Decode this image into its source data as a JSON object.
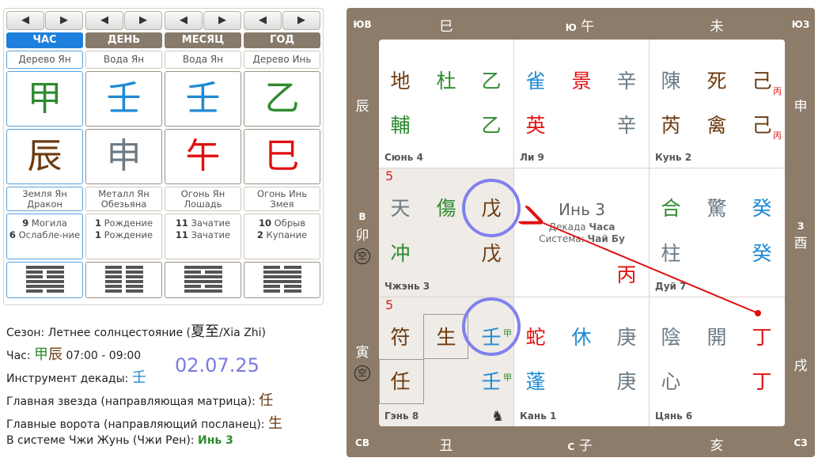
{
  "pillars": [
    {
      "nav_prev": "◀",
      "nav_next": "▶",
      "header": "ЧАС",
      "active": true,
      "element": "Дерево Ян",
      "stem": "甲",
      "stem_color": "#2e8b2e",
      "branch": "辰",
      "branch_color": "#6b3a10",
      "branch_desc": [
        "Земля Ян",
        "Дракон"
      ],
      "states": [
        [
          "9",
          "Могила"
        ],
        [
          "6",
          "Ослабле-ние"
        ]
      ]
    },
    {
      "nav_prev": "◀",
      "nav_next": "▶",
      "header": "ДЕНЬ",
      "active": false,
      "element": "Вода Ян",
      "stem": "壬",
      "stem_color": "#1f8ad6",
      "branch": "申",
      "branch_color": "#6c7a84",
      "branch_desc": [
        "Металл Ян",
        "Обезьяна"
      ],
      "states": [
        [
          "1",
          "Рождение"
        ],
        [
          "1",
          "Рождение"
        ]
      ]
    },
    {
      "nav_prev": "◀",
      "nav_next": "▶",
      "header": "МЕСЯЦ",
      "active": false,
      "element": "Вода Ян",
      "stem": "壬",
      "stem_color": "#1f8ad6",
      "branch": "午",
      "branch_color": "#e01010",
      "branch_desc": [
        "Огонь Ян",
        "Лошадь"
      ],
      "states": [
        [
          "11",
          "Зачатие"
        ],
        [
          "11",
          "Зачатие"
        ]
      ]
    },
    {
      "nav_prev": "◀",
      "nav_next": "▶",
      "header": "ГОД",
      "active": false,
      "element": "Дерево Инь",
      "stem": "乙",
      "stem_color": "#2e8b2e",
      "branch": "巳",
      "branch_color": "#e01010",
      "branch_desc": [
        "Огонь Инь",
        "Змея"
      ],
      "states": [
        [
          "10",
          "Обрыв"
        ],
        [
          "2",
          "Купание"
        ]
      ]
    }
  ],
  "info": {
    "season_label": "Сезон: Летнее солнцестояние (",
    "season_hanzi": "夏至",
    "season_tail": "/Xia Zhi)",
    "hour_label": "Час: ",
    "hour_stem": "甲",
    "hour_branch": "辰",
    "hour_time": " 07:00 - 09:00",
    "decade_label": "Инструмент декады: ",
    "decade_char": "壬",
    "date": "02.07.25",
    "star_label": "Главная звезда (направляющая матрица): ",
    "star_char": "任",
    "gate_label": "Главные ворота (направляющий посланец): ",
    "gate_char": "生",
    "system_label": "В системе Чжи Жунь (Чжи Рен): ",
    "system_value": "Инь 3"
  },
  "frame": {
    "top": [
      "巳",
      "午",
      "未"
    ],
    "top_dir": "Ю",
    "bottom": [
      "丑",
      "子",
      "亥"
    ],
    "bottom_dir": "С",
    "left": [
      "辰",
      "卯",
      "寅"
    ],
    "left_dir": "В",
    "right": [
      "申",
      "酉",
      "戌"
    ],
    "right_dir": "З",
    "corners": {
      "tl": "ЮВ",
      "tr": "ЮЗ",
      "bl": "СВ",
      "br": "СЗ"
    },
    "kong": "空"
  },
  "palaces": [
    {
      "name": "Сюнь 4",
      "chars": [
        [
          "地",
          "#6b3a10"
        ],
        [
          "杜",
          "#2e8b2e"
        ],
        [
          "乙",
          "#2e8b2e"
        ],
        [
          "輔",
          "#2e8b2e"
        ],
        [
          "乙",
          "#2e8b2e"
        ]
      ]
    },
    {
      "name": "Ли 9",
      "chars": [
        [
          "雀",
          "#1f8ad6"
        ],
        [
          "景",
          "#e01010"
        ],
        [
          "辛",
          "#6c7a84"
        ],
        [
          "英",
          "#e01010"
        ],
        [
          "辛",
          "#6c7a84"
        ]
      ]
    },
    {
      "name": "Кунь 2",
      "chars": [
        [
          "陳",
          "#6c7a84"
        ],
        [
          "死",
          "#6b3a10"
        ],
        [
          "己",
          "#6b3a10"
        ],
        [
          "芮",
          "#6b3a10"
        ],
        [
          "禽",
          "#6b3a10"
        ],
        [
          "己",
          "#6b3a10"
        ]
      ],
      "subs": [
        "丙",
        "丙"
      ]
    },
    {
      "name": "Чжэнь 3",
      "num": "5",
      "chars": [
        [
          "天",
          "#6c7a84"
        ],
        [
          "傷",
          "#2e8b2e"
        ],
        [
          "戊",
          "#6b3a10"
        ],
        [
          "冲",
          "#2e8b2e"
        ],
        [
          "戊",
          "#6b3a10"
        ]
      ]
    },
    {
      "name": "",
      "center_title": "Инь 3",
      "center_line1a": "Декада ",
      "center_line1b": "Часа",
      "center_line2a": "Система: ",
      "center_line2b": "Чай Бу",
      "center_char": "丙"
    },
    {
      "name": "Дуй 7",
      "chars": [
        [
          "合",
          "#2e8b2e"
        ],
        [
          "驚",
          "#6c7a84"
        ],
        [
          "癸",
          "#1f8ad6"
        ],
        [
          "柱",
          "#6c7a84"
        ],
        [
          "癸",
          "#1f8ad6"
        ]
      ]
    },
    {
      "name": "Гэнь 8",
      "num": "5",
      "chars": [
        [
          "符",
          "#6b3a10"
        ],
        [
          "生",
          "#6b3a10"
        ],
        [
          "壬",
          "#1f8ad6"
        ],
        [
          "任",
          "#6b3a10"
        ],
        [
          "壬",
          "#1f8ad6"
        ]
      ],
      "subs": [
        "甲",
        "甲"
      ],
      "horse": "♞"
    },
    {
      "name": "Кань 1",
      "chars": [
        [
          "蛇",
          "#e01010"
        ],
        [
          "休",
          "#1f8ad6"
        ],
        [
          "庚",
          "#6c7a84"
        ],
        [
          "蓬",
          "#1f8ad6"
        ],
        [
          "庚",
          "#6c7a84"
        ]
      ]
    },
    {
      "name": "Цянь 6",
      "chars": [
        [
          "陰",
          "#6c7a84"
        ],
        [
          "開",
          "#6c7a84"
        ],
        [
          "丁",
          "#e01010"
        ],
        [
          "心",
          "#6c7a84"
        ],
        [
          "丁",
          "#e01010"
        ]
      ]
    }
  ],
  "colors": {
    "frame": "#8c7c69",
    "active_tab": "#1f7fdc",
    "tab": "#867a6b",
    "annotation": "#8080f0",
    "arrow": "#e01010"
  }
}
